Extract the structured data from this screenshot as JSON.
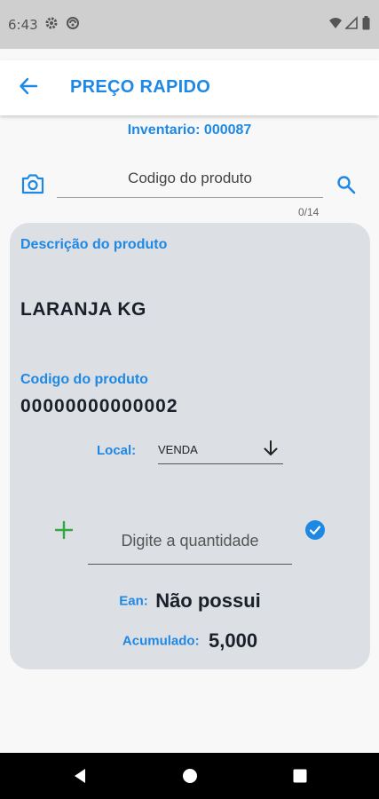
{
  "status_bar": {
    "time": "6:43",
    "icons": [
      "settings-gear-icon",
      "sync-icon",
      "wifi-icon",
      "signal-icon",
      "battery-icon"
    ]
  },
  "app_bar": {
    "back_icon": "arrow-left-icon",
    "title": "PREÇO RAPIDO",
    "accent_color": "#1e88e5"
  },
  "inventory": {
    "text": "Inventario: 000087"
  },
  "search": {
    "camera_icon": "camera-icon",
    "placeholder": "Codigo do produto",
    "value": "",
    "counter": "0/14",
    "search_icon": "search-icon"
  },
  "product": {
    "description_label": "Descrição do produto",
    "name": "LARANJA KG",
    "code_label": "Codigo do produto",
    "code": "00000000000002",
    "local_label": "Local:",
    "local_value": "VENDA",
    "quantity_placeholder": "Digite a quantidade",
    "ean_label": "Ean:",
    "ean_value": "Não possui",
    "accumulated_label": "Acumulado:",
    "accumulated_value": "5,000"
  },
  "nav_bar": {
    "buttons": [
      "back-triangle-icon",
      "home-circle-icon",
      "recents-square-icon"
    ]
  }
}
